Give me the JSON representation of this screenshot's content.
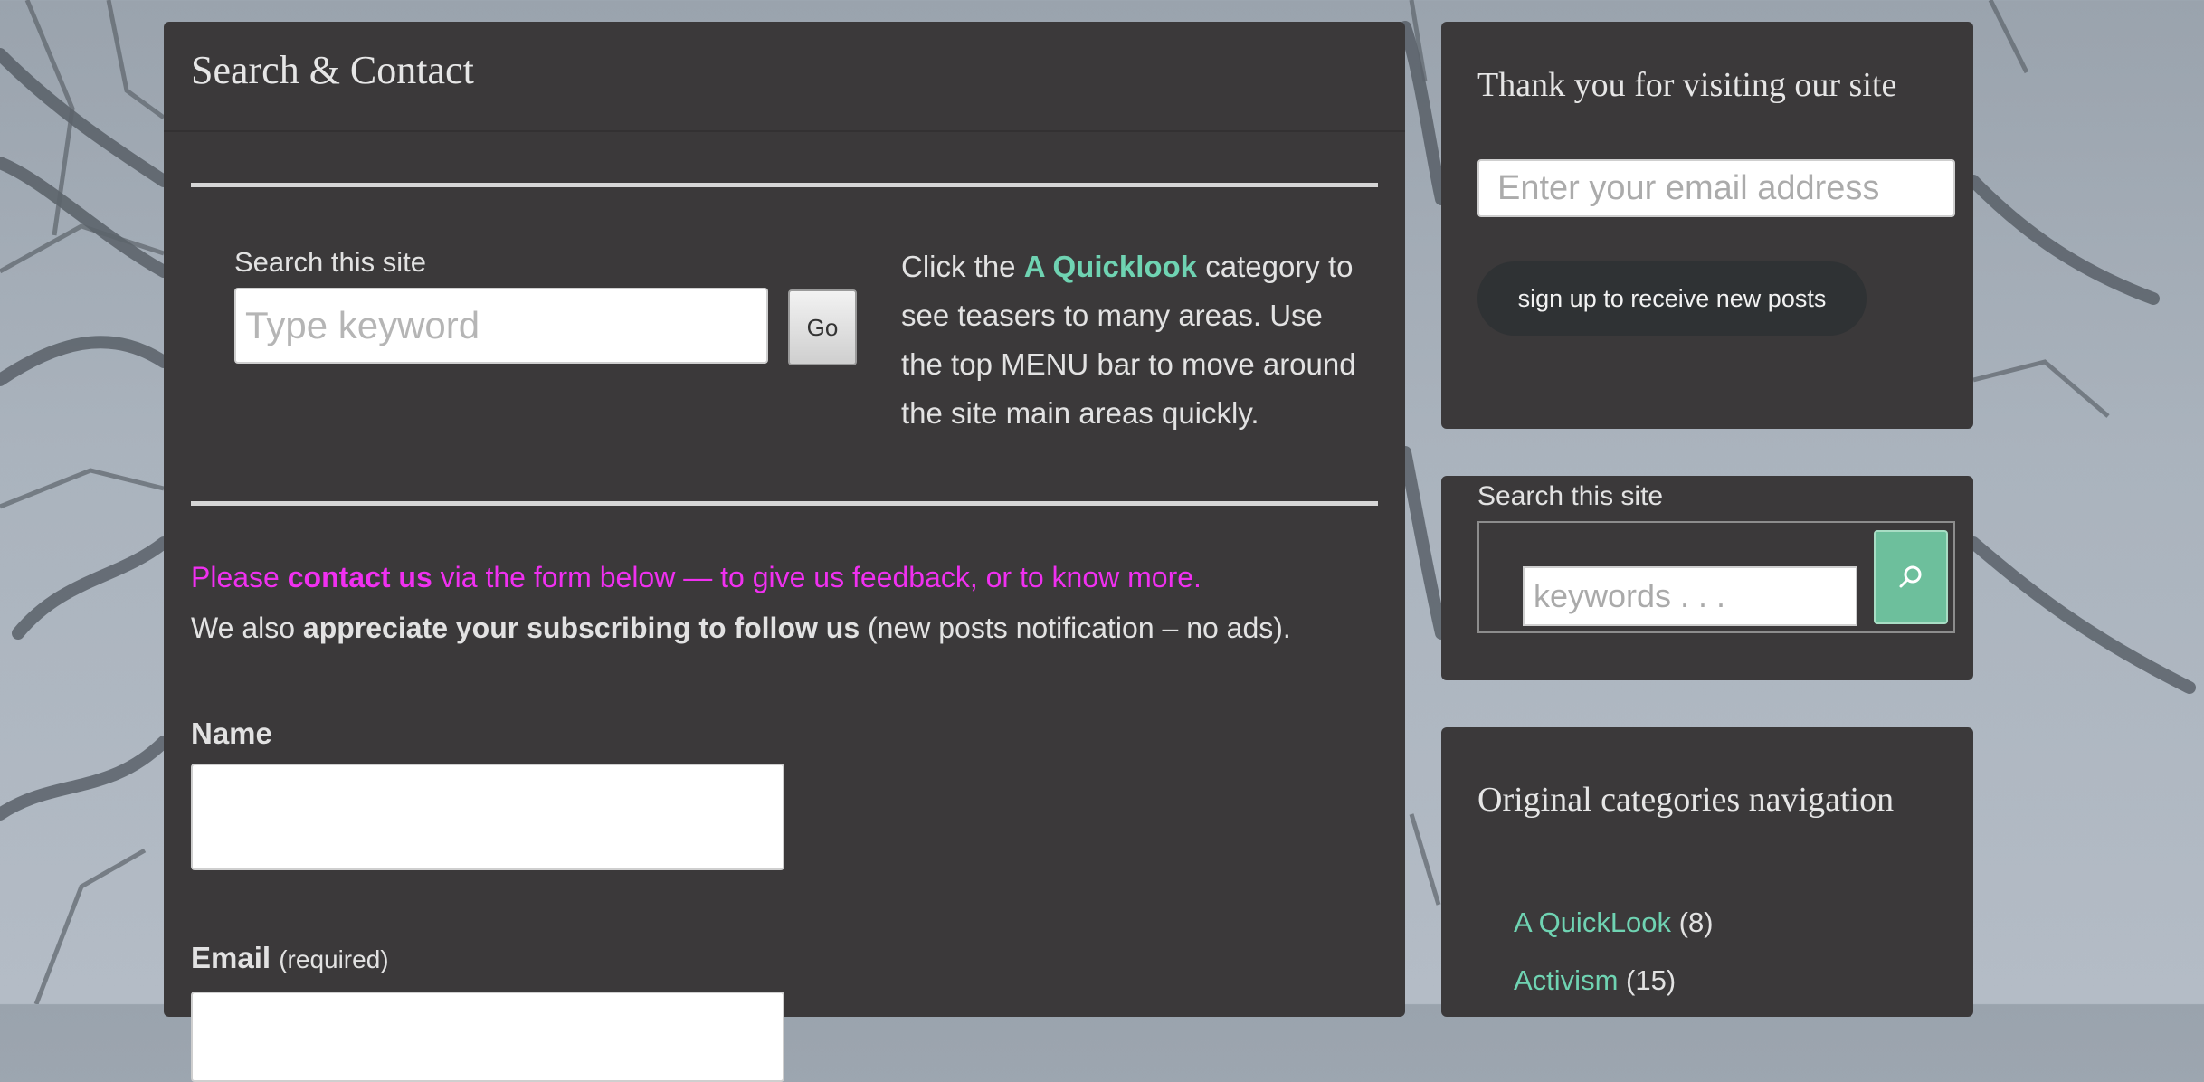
{
  "main": {
    "title": "Search & Contact",
    "search": {
      "label": "Search this site",
      "placeholder": "Type keyword",
      "button_label": "Go"
    },
    "quicklook": {
      "prefix": "Click the ",
      "link": "A Quicklook",
      "suffix": " category to see teasers to many areas. Use the top MENU bar to move around the site main areas quickly."
    },
    "contact": {
      "line1_prefix": "Please ",
      "line1_link": "contact us",
      "line1_suffix": " via the form below — to give us feedback, or to know more.",
      "line2_prefix": "We also ",
      "line2_bold": "appreciate your subscribing to follow us",
      "line2_suffix": " (new posts notification – no ads)."
    },
    "form": {
      "name_label": "Name",
      "email_label": "Email",
      "email_required": "(required)"
    }
  },
  "sidebar": {
    "signup": {
      "title": "Thank you for visiting our site",
      "email_placeholder": "Enter your email address",
      "button_label": "sign up to receive new posts"
    },
    "search": {
      "label": "Search this site",
      "placeholder": "keywords . . ."
    },
    "categories": {
      "title": "Original categories navigation",
      "items": [
        {
          "label": "A QuickLook",
          "count": "(8)"
        },
        {
          "label": "Activism",
          "count": "(15)"
        }
      ]
    }
  },
  "colors": {
    "panel_bg": "#3b393a",
    "link": "#6fd3b2",
    "highlight": "#f030f0",
    "search_button": "#6dbf9c"
  },
  "icons": {
    "search_widget_button": "search-icon"
  }
}
